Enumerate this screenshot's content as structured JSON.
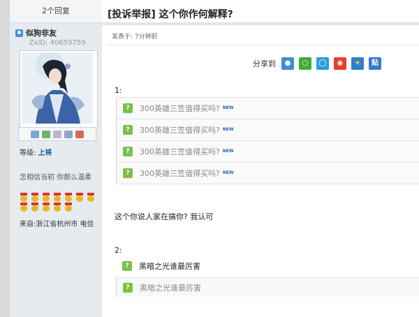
{
  "sidebar": {
    "reply_count": "2个回复",
    "username": "似狗非友",
    "zxid": "ZxID: 40659759",
    "level_prefix": "等级: ",
    "level_value": "上将",
    "signature": "怎相信当初 你那么温柔",
    "location": "来自:浙江省杭州市 电信"
  },
  "post": {
    "title": "[投诉举报] 这个你作何解释?",
    "posted_time": "发表于: 7分钟前",
    "share_label": "分享到",
    "share_icons": [
      "qq-icon",
      "wechat-icon",
      "qzone-icon",
      "weibo-icon",
      "favorite-icon",
      "tieba-icon"
    ],
    "share_tieba_text": "贴",
    "section1_label": "1:",
    "section1_links": [
      {
        "text": "300英雄三笠值得买吗?",
        "badge": "NEW"
      },
      {
        "text": "300英雄三笠值得买吗?",
        "badge": "NEW"
      },
      {
        "text": "300英雄三笠值得买吗?",
        "badge": "NEW"
      },
      {
        "text": "300英雄三笠值得买吗?",
        "badge": "NEW"
      }
    ],
    "body": "这个你说人家在搞你? 我认可",
    "section2_label": "2:",
    "section2_links": [
      {
        "text": "黑暗之光谁最厉害"
      },
      {
        "text": "黑暗之光谁最厉害"
      }
    ]
  },
  "colors": {
    "sidebar_bg": "#e6ebef",
    "level_color": "#1a5a9a",
    "link_icon_green": "#7cc04b",
    "new_badge": "#2a5fb0"
  }
}
